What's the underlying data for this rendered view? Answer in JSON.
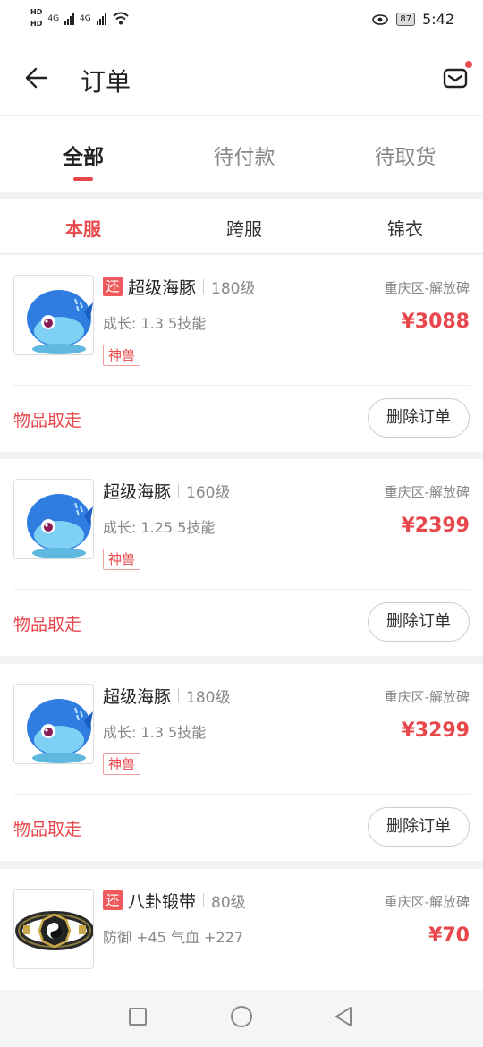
{
  "status_bar": {
    "hd1": "HD",
    "hd2": "HD",
    "net1": "4G",
    "net2": "4G",
    "battery": "87",
    "time": "5:42"
  },
  "header": {
    "title": "订单",
    "back_icon": "arrow-left-icon",
    "mail_icon": "mail-icon"
  },
  "tabs": [
    "全部",
    "待付款",
    "待取货"
  ],
  "subtabs": [
    "本服",
    "跨服",
    "锦衣"
  ],
  "orders": [
    {
      "badge": "还",
      "name": "超级海豚",
      "level": "180级",
      "location": "重庆区-解放碑",
      "stats": "成长: 1.3  5技能",
      "price": "¥3088",
      "tag": "神兽",
      "status": "物品取走",
      "action": "删除订单"
    },
    {
      "badge": "",
      "name": "超级海豚",
      "level": "160级",
      "location": "重庆区-解放碑",
      "stats": "成长: 1.25  5技能",
      "price": "¥2399",
      "tag": "神兽",
      "status": "物品取走",
      "action": "删除订单"
    },
    {
      "badge": "",
      "name": "超级海豚",
      "level": "180级",
      "location": "重庆区-解放碑",
      "stats": "成长: 1.3  5技能",
      "price": "¥3299",
      "tag": "神兽",
      "status": "物品取走",
      "action": "删除订单"
    },
    {
      "badge": "还",
      "name": "八卦锻带",
      "level": "80级",
      "location": "重庆区-解放碑",
      "stats": "防御 +45 气血 +227",
      "price": "¥70"
    }
  ],
  "colors": {
    "accent": "#e8474b",
    "muted": "#888888"
  }
}
